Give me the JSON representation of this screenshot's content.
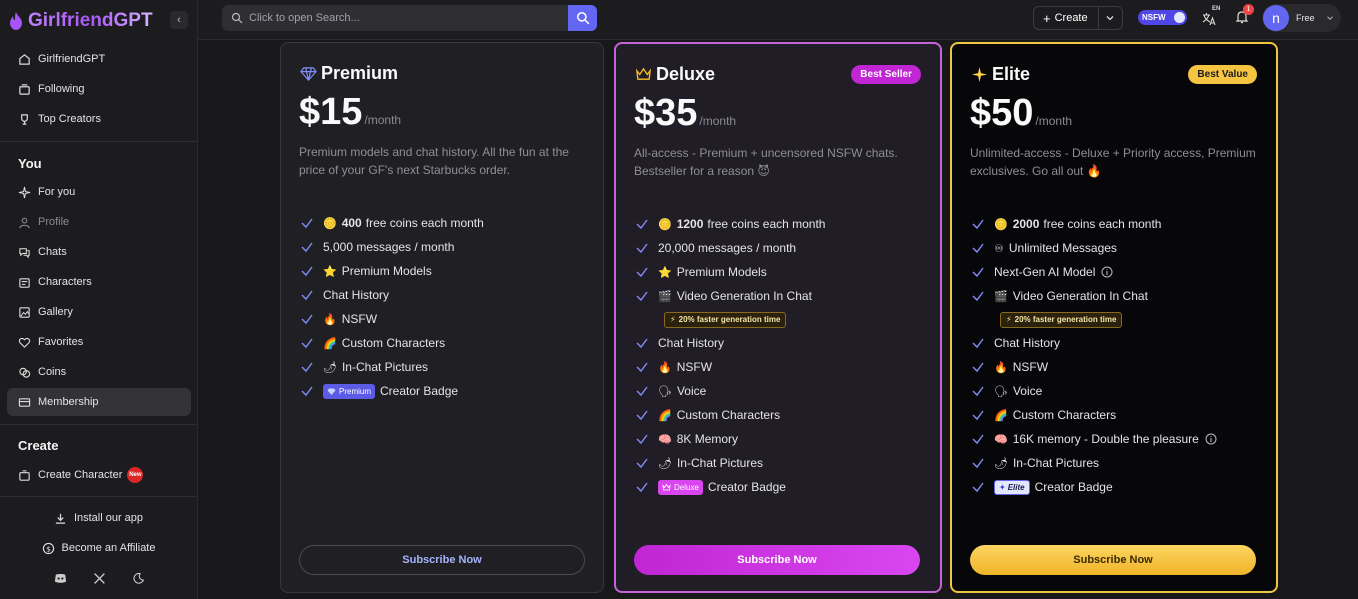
{
  "app": {
    "name": "GirlfriendGPT"
  },
  "colors": {
    "accent": "#6366f1",
    "deluxe": "#c564d9",
    "elite": "#f0c63e"
  },
  "sidebar": {
    "top_items": [
      {
        "label": "GirlfriendGPT",
        "icon": "home-icon"
      },
      {
        "label": "Following",
        "icon": "following-icon"
      },
      {
        "label": "Top Creators",
        "icon": "trophy-icon"
      }
    ],
    "you_heading": "You",
    "you_items": [
      {
        "label": "For you",
        "icon": "sparkle-icon"
      },
      {
        "label": "Profile",
        "icon": "user-icon"
      },
      {
        "label": "Chats",
        "icon": "chat-icon"
      },
      {
        "label": "Characters",
        "icon": "characters-icon"
      },
      {
        "label": "Gallery",
        "icon": "gallery-icon"
      },
      {
        "label": "Favorites",
        "icon": "heart-icon"
      },
      {
        "label": "Coins",
        "icon": "coins-icon"
      },
      {
        "label": "Membership",
        "icon": "card-icon"
      }
    ],
    "create_heading": "Create",
    "create_item": {
      "label": "Create Character",
      "badge": "New"
    },
    "footer": {
      "install": "Install our app",
      "affiliate": "Become an Affiliate"
    }
  },
  "topbar": {
    "search_placeholder": "Click to open Search...",
    "create_label": "Create",
    "nsfw_label": "NSFW",
    "lang": "EN",
    "notif_count": "1",
    "avatar_letter": "n",
    "plan": "Free"
  },
  "plans": {
    "premium": {
      "name": "Premium",
      "price": "$15",
      "period": "/month",
      "desc": "Premium models and chat history. All the fun at the price of your GF's next Starbucks order.",
      "coins_bold": "400",
      "coins_text": "free coins each month",
      "features": [
        "5,000 messages / month",
        "Premium Models",
        "Chat History",
        "NSFW",
        "Custom Characters",
        "In-Chat Pictures"
      ],
      "badge_label": "Premium",
      "badge_text": "Creator Badge",
      "cta": "Subscribe Now"
    },
    "deluxe": {
      "name": "Deluxe",
      "tag": "Best Seller",
      "price": "$35",
      "period": "/month",
      "desc": "All-access - Premium + uncensored NSFW chats. Bestseller for a reason 😈",
      "coins_bold": "1200",
      "coins_text": "free coins each month",
      "features": [
        "20,000 messages / month",
        "Premium Models",
        "Video Generation In Chat"
      ],
      "speed": "20% faster generation time",
      "features2": [
        "Chat History",
        "NSFW",
        "Voice",
        "Custom Characters",
        "8K Memory",
        "In-Chat Pictures"
      ],
      "badge_label": "Deluxe",
      "badge_text": "Creator Badge",
      "cta": "Subscribe Now"
    },
    "elite": {
      "name": "Elite",
      "tag": "Best Value",
      "price": "$50",
      "period": "/month",
      "desc": "Unlimited-access - Deluxe + Priority access, Premium exclusives. Go all out 🔥",
      "coins_bold": "2000",
      "coins_text": "free coins each month",
      "features": [
        "Unlimited Messages",
        "Next-Gen AI Model",
        "Video Generation In Chat"
      ],
      "speed": "20% faster generation time",
      "features2": [
        "Chat History",
        "NSFW",
        "Voice",
        "Custom Characters",
        "16K memory - Double the pleasure",
        "In-Chat Pictures"
      ],
      "badge_label": "Elite",
      "badge_text": "Creator Badge",
      "cta": "Subscribe Now"
    }
  }
}
